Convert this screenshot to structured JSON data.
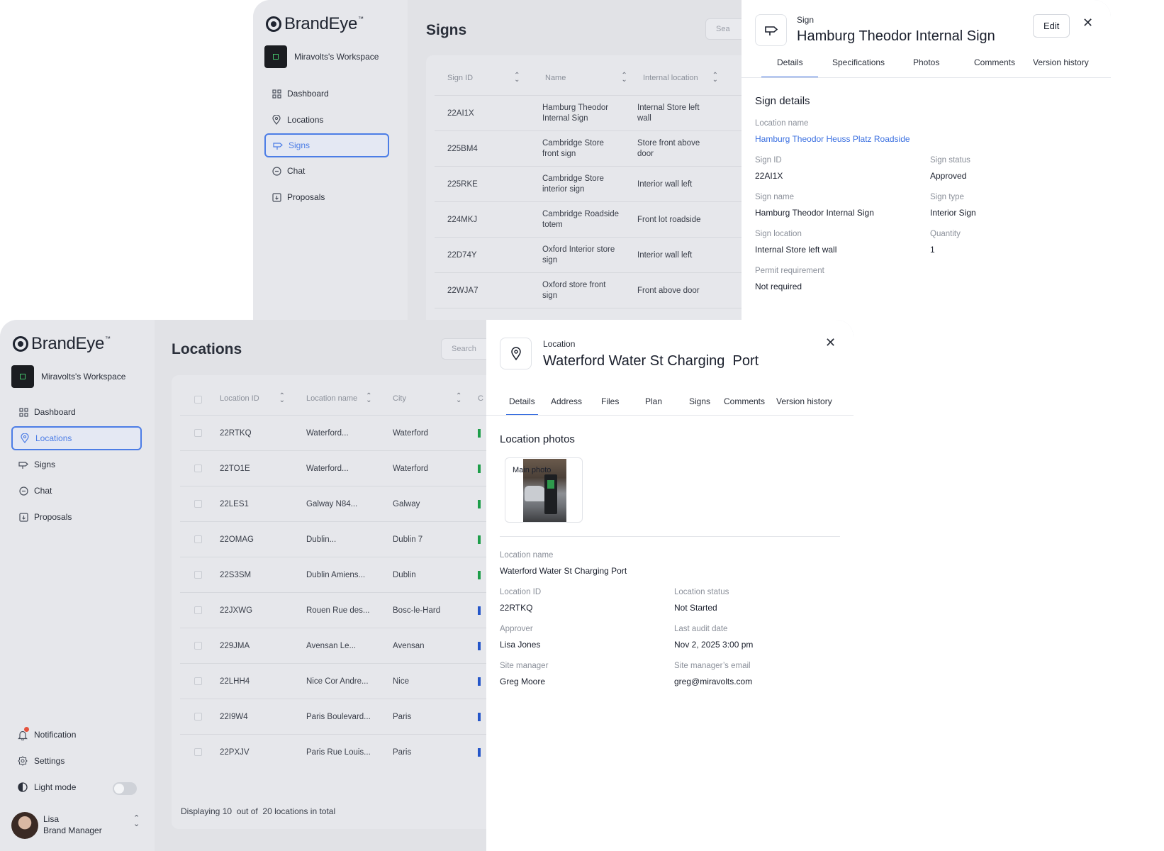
{
  "brand": {
    "name": "BrandEye",
    "tm": "™"
  },
  "workspace": {
    "name": "Miravolts's Workspace"
  },
  "nav": {
    "dashboard": "Dashboard",
    "locations": "Locations",
    "signs": "Signs",
    "chat": "Chat",
    "proposals": "Proposals"
  },
  "signs_page": {
    "title": "Signs",
    "search_placeholder": "Sea",
    "columns": [
      "Sign ID",
      "Name",
      "Internal location"
    ],
    "rows": [
      {
        "id": "22AI1X",
        "name": "Hamburg Theodor Internal Sign",
        "loc": "Internal Store left wall"
      },
      {
        "id": "225BM4",
        "name": "Cambridge Store front sign",
        "loc": "Store front above door"
      },
      {
        "id": "225RKE",
        "name": "Cambridge Store interior sign",
        "loc": "Interior wall left"
      },
      {
        "id": "224MKJ",
        "name": "Cambridge Roadside totem",
        "loc": "Front lot roadside"
      },
      {
        "id": "22D74Y",
        "name": "Oxford Interior store sign",
        "loc": "Interior wall left"
      },
      {
        "id": "22WJA7",
        "name": "Oxford store front sign",
        "loc": "Front above door"
      }
    ]
  },
  "sign_panel": {
    "kicker": "Sign",
    "title": "Hamburg Theodor Internal Sign",
    "edit_label": "Edit",
    "tabs": [
      "Details",
      "Specifications",
      "Photos",
      "Comments",
      "Version history"
    ],
    "section_title": "Sign details",
    "fields": {
      "location_name_label": "Location name",
      "location_name": "Hamburg Theodor Heuss Platz Roadside",
      "sign_id_label": "Sign ID",
      "sign_id": "22AI1X",
      "sign_status_label": "Sign status",
      "sign_status": "Approved",
      "sign_name_label": "Sign name",
      "sign_name": "Hamburg Theodor Internal Sign",
      "sign_type_label": "Sign type",
      "sign_type": "Interior Sign",
      "sign_location_label": "Sign location",
      "sign_location": "Internal Store left wall",
      "quantity_label": "Quantity",
      "quantity": "1",
      "permit_label": "Permit requirement",
      "permit": "Not required"
    }
  },
  "locations_page": {
    "title": "Locations",
    "search_placeholder": "Search",
    "columns": [
      "Location ID",
      "Location name",
      "City",
      "C"
    ],
    "rows": [
      {
        "id": "22RTKQ",
        "name": "Waterford...",
        "city": "Waterford",
        "status_color": "#1e9e4a"
      },
      {
        "id": "22TO1E",
        "name": "Waterford...",
        "city": "Waterford",
        "status_color": "#1e9e4a"
      },
      {
        "id": "22LES1",
        "name": "Galway N84...",
        "city": "Galway",
        "status_color": "#1e9e4a"
      },
      {
        "id": "22OMAG",
        "name": "Dublin...",
        "city": "Dublin 7",
        "status_color": "#1e9e4a"
      },
      {
        "id": "22S3SM",
        "name": "Dublin Amiens...",
        "city": "Dublin",
        "status_color": "#1e9e4a"
      },
      {
        "id": "22JXWG",
        "name": "Rouen Rue des...",
        "city": "Bosc-le-Hard",
        "status_color": "#2456c9"
      },
      {
        "id": "229JMA",
        "name": "Avensan Le...",
        "city": "Avensan",
        "status_color": "#2456c9"
      },
      {
        "id": "22LHH4",
        "name": "Nice Cor Andre...",
        "city": "Nice",
        "status_color": "#2456c9"
      },
      {
        "id": "22I9W4",
        "name": "Paris Boulevard...",
        "city": "Paris",
        "status_color": "#2456c9"
      },
      {
        "id": "22PXJV",
        "name": "Paris Rue Louis...",
        "city": "Paris",
        "status_color": "#2456c9"
      }
    ],
    "footer": "Displaying 10  out of  20 locations in total"
  },
  "sidebar_bottom": {
    "notification": "Notification",
    "settings": "Settings",
    "light_mode": "Light mode",
    "user_name": "Lisa",
    "user_role": "Brand Manager"
  },
  "location_panel": {
    "kicker": "Location",
    "title": "Waterford Water St Charging  Port",
    "tabs": [
      "Details",
      "Address",
      "Files",
      "Plan",
      "Signs",
      "Comments",
      "Version history"
    ],
    "section_title": "Location photos",
    "photo_label": "Main photo",
    "fields": {
      "location_name_label": "Location name",
      "location_name": "Waterford Water St Charging Port",
      "location_id_label": "Location ID",
      "location_id": "22RTKQ",
      "location_status_label": "Location status",
      "location_status": "Not Started",
      "approver_label": "Approver",
      "approver": "Lisa Jones",
      "last_audit_label": "Last audit date",
      "last_audit": "Nov 2, 2025 3:00 pm",
      "site_manager_label": "Site manager",
      "site_manager": "Greg Moore",
      "site_email_label": "Site manager’s email",
      "site_email": "greg@miravolts.com"
    }
  },
  "colors": {
    "accent": "#3a6fe0",
    "active_nav": "#4c7de6",
    "notif_dot": "#e5533d"
  }
}
